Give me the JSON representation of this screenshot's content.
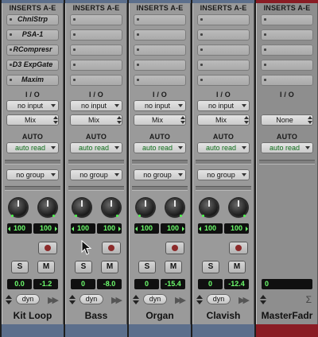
{
  "labels": {
    "inserts": "INSERTS A-E",
    "io": "I / O",
    "auto": "AUTO",
    "dyn": "dyn",
    "solo": "S",
    "mute": "M"
  },
  "colors": {
    "strip_color": "#5c6f8c",
    "master_color": "#8a1c24",
    "meter_text": "#6dff6d",
    "automation_text": "#0e6e1a"
  },
  "tracks": [
    {
      "name": "Kit Loop",
      "inserts": [
        "ChnlStrp",
        "PSA-1",
        "RCompresr",
        "D3 ExpGate",
        "Maxim"
      ],
      "input": "no input",
      "output": "Mix",
      "automation": "auto read",
      "group": "no group",
      "pan_left": "100",
      "pan_right": "100",
      "volume": "0.0",
      "peak": "-1.2"
    },
    {
      "name": "Bass",
      "inserts": [
        "",
        "",
        "",
        "",
        ""
      ],
      "input": "no input",
      "output": "Mix",
      "automation": "auto read",
      "group": "no group",
      "pan_left": "100",
      "pan_right": "100",
      "volume": "0",
      "peak": "-8.0"
    },
    {
      "name": "Organ",
      "inserts": [
        "",
        "",
        "",
        "",
        ""
      ],
      "input": "no input",
      "output": "Mix",
      "automation": "auto read",
      "group": "no group",
      "pan_left": "100",
      "pan_right": "100",
      "volume": "0",
      "peak": "-15.4"
    },
    {
      "name": "Clavish",
      "inserts": [
        "",
        "",
        "",
        "",
        ""
      ],
      "input": "no input",
      "output": "Mix",
      "automation": "auto read",
      "group": "no group",
      "pan_left": "100",
      "pan_right": "100",
      "volume": "0",
      "peak": "-12.4"
    }
  ],
  "master": {
    "name": "MasterFadr",
    "inserts": [
      "",
      "",
      "",
      "",
      ""
    ],
    "output": "None",
    "automation": "auto read",
    "volume": "0"
  }
}
